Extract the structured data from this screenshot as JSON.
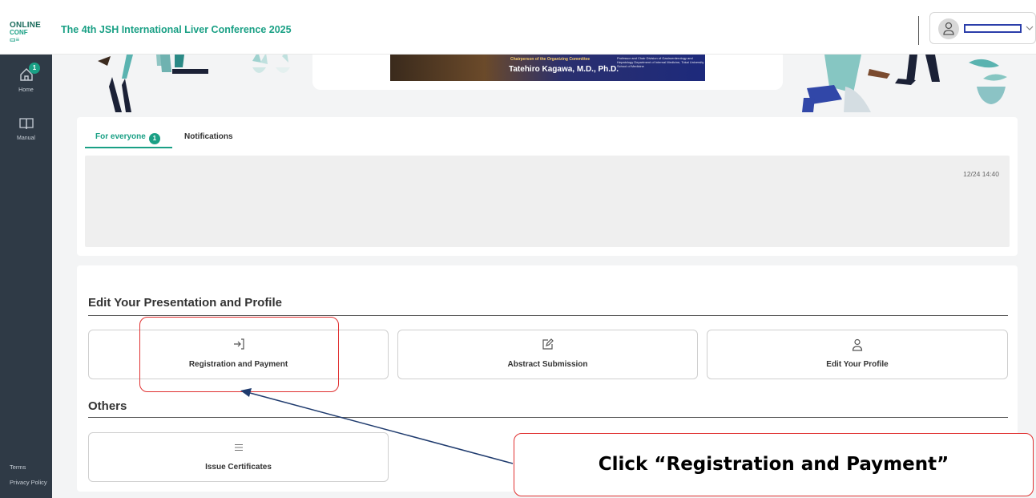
{
  "header": {
    "logo_top": "ONLINE",
    "logo_bottom": "CONF",
    "conference_title": "The 4th JSH International Liver Conference 2025",
    "user_name": "",
    "icons": [
      "user-icon",
      "chevron-down-icon"
    ]
  },
  "sidebar": {
    "items": [
      {
        "label": "Home",
        "icon": "home-icon",
        "badge": "1"
      },
      {
        "label": "Manual",
        "icon": "book-icon"
      }
    ],
    "footer": {
      "terms": "Terms",
      "privacy": "Privacy Policy"
    }
  },
  "banner": {
    "chair_role": "Chairperson of the Organizing Committee",
    "chair_name": "Tatehiro Kagawa, M.D., Ph.D.",
    "chair_affiliation": "Professor and Chair Division of Gastroenterology and Hepatology Department of Internal Medicine, Tokai University School of Medicine"
  },
  "notices": {
    "tabs": [
      {
        "label": "For everyone",
        "badge": "1",
        "active": true
      },
      {
        "label": "Notifications",
        "active": false
      }
    ],
    "time": "12/24 14:40"
  },
  "edit_section": {
    "title": "Edit Your Presentation and Profile",
    "cards": [
      {
        "label": "Registration and Payment",
        "icon": "sign-in-icon"
      },
      {
        "label": "Abstract Submission",
        "icon": "edit-icon"
      },
      {
        "label": "Edit Your Profile",
        "icon": "user-icon"
      }
    ]
  },
  "others_section": {
    "title": "Others",
    "cards": [
      {
        "label": "Issue Certificates",
        "icon": "menu-icon"
      }
    ]
  },
  "annotation": {
    "callout_text": "Click “Registration and Payment”",
    "highlight_color": "#e03030",
    "arrow_color": "#1f3b6e"
  },
  "colors": {
    "accent": "#1aa085",
    "sidebar_bg": "#2f3a46",
    "page_bg": "#f3f4f5"
  }
}
